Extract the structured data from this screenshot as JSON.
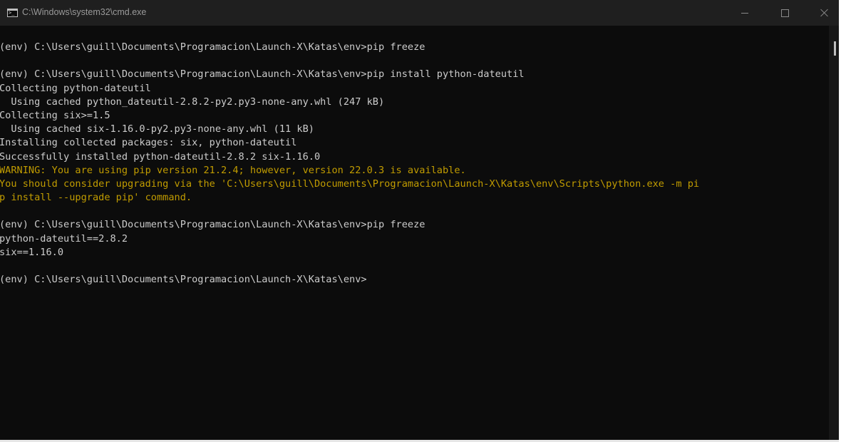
{
  "window": {
    "title": "C:\\Windows\\system32\\cmd.exe",
    "icon": "cmd-console-icon",
    "controls": {
      "minimize_icon": "minimize-icon",
      "maximize_icon": "maximize-icon",
      "close_icon": "close-icon"
    }
  },
  "colors": {
    "background": "#0c0c0c",
    "titlebar": "#1f1f1f",
    "text": "#cccccc",
    "warning": "#c19c00"
  },
  "console": {
    "lines": [
      {
        "text": "(env) C:\\Users\\guill\\Documents\\Programacion\\Launch-X\\Katas\\env>pip freeze",
        "type": "normal"
      },
      {
        "text": "",
        "type": "normal"
      },
      {
        "text": "(env) C:\\Users\\guill\\Documents\\Programacion\\Launch-X\\Katas\\env>pip install python-dateutil",
        "type": "normal"
      },
      {
        "text": "Collecting python-dateutil",
        "type": "normal"
      },
      {
        "text": "  Using cached python_dateutil-2.8.2-py2.py3-none-any.whl (247 kB)",
        "type": "normal"
      },
      {
        "text": "Collecting six>=1.5",
        "type": "normal"
      },
      {
        "text": "  Using cached six-1.16.0-py2.py3-none-any.whl (11 kB)",
        "type": "normal"
      },
      {
        "text": "Installing collected packages: six, python-dateutil",
        "type": "normal"
      },
      {
        "text": "Successfully installed python-dateutil-2.8.2 six-1.16.0",
        "type": "normal"
      },
      {
        "text": "WARNING: You are using pip version 21.2.4; however, version 22.0.3 is available.",
        "type": "warn"
      },
      {
        "text": "You should consider upgrading via the 'C:\\Users\\guill\\Documents\\Programacion\\Launch-X\\Katas\\env\\Scripts\\python.exe -m pi",
        "type": "warn"
      },
      {
        "text": "p install --upgrade pip' command.",
        "type": "warn"
      },
      {
        "text": "",
        "type": "normal"
      },
      {
        "text": "(env) C:\\Users\\guill\\Documents\\Programacion\\Launch-X\\Katas\\env>pip freeze",
        "type": "normal"
      },
      {
        "text": "python-dateutil==2.8.2",
        "type": "normal"
      },
      {
        "text": "six==1.16.0",
        "type": "normal"
      },
      {
        "text": "",
        "type": "normal"
      },
      {
        "text": "(env) C:\\Users\\guill\\Documents\\Programacion\\Launch-X\\Katas\\env>",
        "type": "normal"
      }
    ]
  }
}
